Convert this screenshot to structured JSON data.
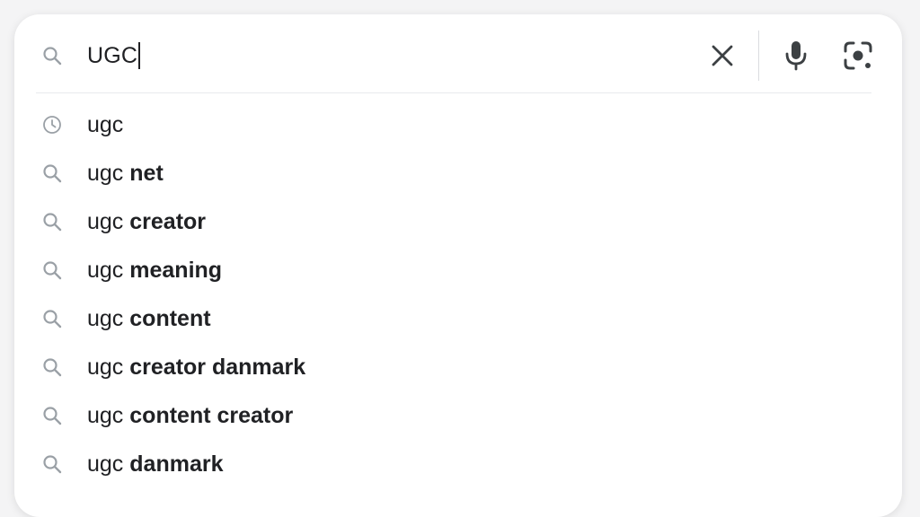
{
  "search": {
    "query": "UGC",
    "icons": {
      "leading": "search-icon",
      "clear": "close-icon",
      "voice": "mic-icon",
      "lens": "camera-lens-icon"
    }
  },
  "suggestions": [
    {
      "icon": "history-icon",
      "prefix": "ugc",
      "completion": ""
    },
    {
      "icon": "search-icon",
      "prefix": "ugc",
      "completion": "net"
    },
    {
      "icon": "search-icon",
      "prefix": "ugc",
      "completion": "creator"
    },
    {
      "icon": "search-icon",
      "prefix": "ugc",
      "completion": "meaning"
    },
    {
      "icon": "search-icon",
      "prefix": "ugc",
      "completion": "content"
    },
    {
      "icon": "search-icon",
      "prefix": "ugc",
      "completion": "creator danmark"
    },
    {
      "icon": "search-icon",
      "prefix": "ugc",
      "completion": "content creator"
    },
    {
      "icon": "search-icon",
      "prefix": "ugc",
      "completion": "danmark"
    }
  ],
  "colors": {
    "text": "#202124",
    "icon_gray": "#9aa0a6",
    "action_icon": "#3c4043"
  }
}
